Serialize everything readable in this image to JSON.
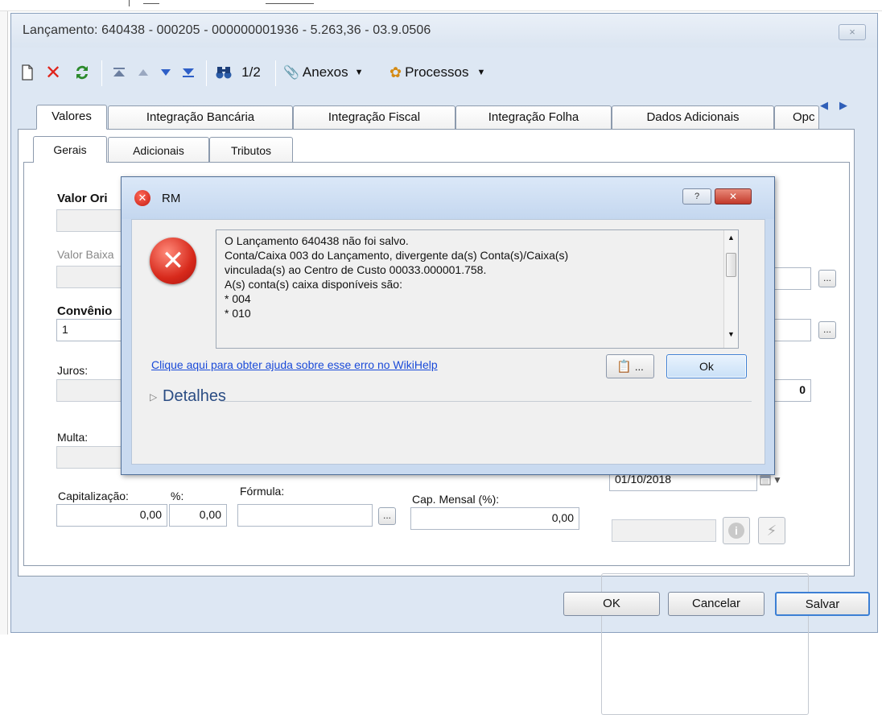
{
  "window": {
    "title": "Lançamento: 640438 - 000205 - 000000001936 - 5.263,36 - 03.9.0506",
    "close_label": "×"
  },
  "toolbar": {
    "page_indicator": "1/2",
    "attachments_label": "Anexos",
    "processes_label": "Processos"
  },
  "tabs": [
    {
      "label": "Valores"
    },
    {
      "label": "Integração Bancária"
    },
    {
      "label": "Integração Fiscal"
    },
    {
      "label": "Integração Folha"
    },
    {
      "label": "Dados Adicionais"
    },
    {
      "label": "Opc"
    }
  ],
  "subtabs": [
    {
      "label": "Gerais"
    },
    {
      "label": "Adicionais"
    },
    {
      "label": "Tributos"
    }
  ],
  "form": {
    "valor_original_label": "Valor Ori",
    "valor_baixa_label": "Valor Baixa",
    "convenio_label": "Convênio",
    "convenio_value": "1",
    "juros_label": "Juros:",
    "multa_label": "Multa:",
    "right_value": "0",
    "date_value": "01/10/2018",
    "capitalizacao_label": "Capitalização:",
    "capitalizacao_value": "0,00",
    "percent_label": "%:",
    "percent_value": "0,00",
    "formula_label": "Fórmula:",
    "formula_value": "",
    "cap_mensal_label": "Cap. Mensal (%):",
    "cap_mensal_value": "0,00",
    "ellipsis": "..."
  },
  "buttons": {
    "ok": "OK",
    "cancel": "Cancelar",
    "save": "Salvar"
  },
  "dialog": {
    "title": "RM",
    "help_btn": "?",
    "close_btn": "✕",
    "message_lines": [
      "O Lançamento 640438  não foi salvo.",
      "Conta/Caixa 003 do Lançamento, divergente da(s) Conta(s)/Caixa(s)",
      "vinculada(s) ao Centro de Custo 00033.000001.758.",
      "A(s) conta(s) caixa disponíveis são:",
      "* 004",
      "* 010"
    ],
    "help_link": "Clique aqui para obter ajuda sobre esse erro no WikiHelp",
    "copy_btn_label": "...",
    "ok_label": "Ok",
    "details_label": "Detalhes"
  }
}
